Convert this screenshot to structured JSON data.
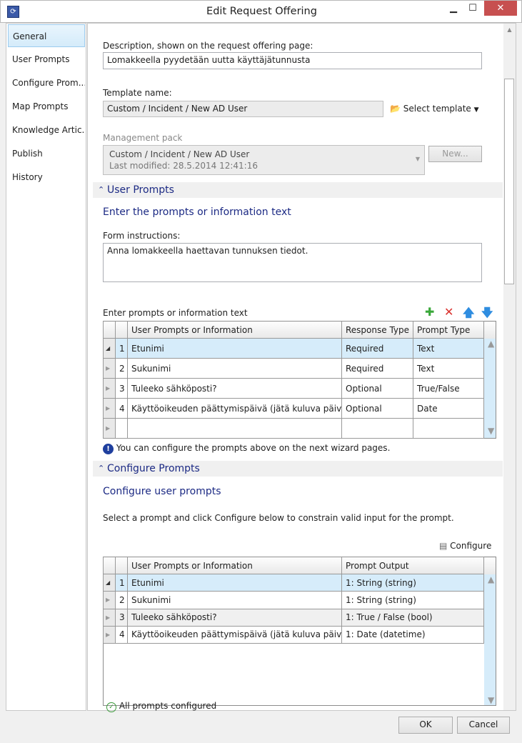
{
  "window": {
    "title": "Edit Request Offering",
    "minimize": "▁",
    "maximize": "☐",
    "close": "✕"
  },
  "nav": {
    "items": [
      {
        "label": "General",
        "selected": true
      },
      {
        "label": "User Prompts"
      },
      {
        "label": "Configure Prom..."
      },
      {
        "label": "Map Prompts"
      },
      {
        "label": "Knowledge Artic..."
      },
      {
        "label": "Publish"
      },
      {
        "label": "History"
      }
    ]
  },
  "general": {
    "description_label": "Description, shown on the request offering page:",
    "description_value": "Lomakkeella pyydetään uutta käyttäjätunnusta",
    "template_label": "Template name:",
    "template_value": "Custom / Incident / New AD User",
    "select_template": "Select template",
    "mp_label": "Management pack",
    "mp_value": "Custom / Incident / New AD User",
    "mp_modified": "Last modified:  28.5.2014 12:41:16",
    "new_button": "New..."
  },
  "user_prompts": {
    "header": "User Prompts",
    "title": "Enter the prompts or information text",
    "form_instructions_label": "Form instructions:",
    "form_instructions_value": "Anna lomakkeella haettavan tunnuksen tiedot.",
    "grid_label": "Enter prompts or information text",
    "columns": [
      "User Prompts or Information",
      "Response Type",
      "Prompt Type"
    ],
    "rows": [
      {
        "n": "1",
        "prompt": "Etunimi",
        "response": "Required",
        "type": "Text"
      },
      {
        "n": "2",
        "prompt": "Sukunimi",
        "response": "Required",
        "type": "Text"
      },
      {
        "n": "3",
        "prompt": "Tuleeko sähköposti?",
        "response": "Optional",
        "type": "True/False"
      },
      {
        "n": "4",
        "prompt": "Käyttöoikeuden päättymispäivä (jätä kuluva päivä jos ja",
        "response": "Optional",
        "type": "Date"
      }
    ],
    "info": "You can configure the prompts above on the next wizard pages."
  },
  "configure": {
    "header": "Configure Prompts",
    "title": "Configure user prompts",
    "instructions": "Select a prompt and click Configure below to constrain valid input for the prompt.",
    "configure_button": "Configure",
    "columns": [
      "User Prompts or Information",
      "Prompt Output"
    ],
    "rows": [
      {
        "n": "1",
        "prompt": "Etunimi",
        "output": "1: String (string)"
      },
      {
        "n": "2",
        "prompt": "Sukunimi",
        "output": "1: String (string)"
      },
      {
        "n": "3",
        "prompt": "Tuleeko sähköposti?",
        "output": "1: True / False (bool)"
      },
      {
        "n": "4",
        "prompt": "Käyttöoikeuden päättymispäivä (jätä kuluva päivä jos ja",
        "output": "1: Date (datetime)"
      }
    ],
    "status": "All prompts configured"
  },
  "footer": {
    "ok": "OK",
    "cancel": "Cancel"
  }
}
